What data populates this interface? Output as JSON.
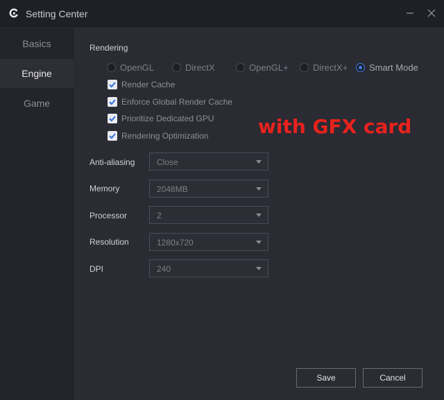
{
  "window": {
    "title": "Setting Center",
    "logo_icon": "app-logo-icon",
    "minimize_icon": "minimize-icon",
    "close_icon": "close-icon"
  },
  "sidebar": {
    "items": [
      {
        "label": "Basics",
        "active": false
      },
      {
        "label": "Engine",
        "active": true
      },
      {
        "label": "Game",
        "active": false
      }
    ]
  },
  "rendering": {
    "title": "Rendering",
    "modes": [
      {
        "label": "OpenGL",
        "selected": false
      },
      {
        "label": "DirectX",
        "selected": false
      },
      {
        "label": "OpenGL+",
        "selected": false
      },
      {
        "label": "DirectX+",
        "selected": false
      },
      {
        "label": "Smart Mode",
        "selected": true
      }
    ],
    "options": [
      {
        "label": "Render Cache",
        "checked": true
      },
      {
        "label": "Enforce Global Render Cache",
        "checked": true
      },
      {
        "label": "Prioritize Dedicated GPU",
        "checked": true
      },
      {
        "label": "Rendering Optimization",
        "checked": true
      }
    ]
  },
  "overlay_text": "with GFX card",
  "settings": [
    {
      "label": "Anti-aliasing",
      "value": "Close"
    },
    {
      "label": "Memory",
      "value": "2048MB"
    },
    {
      "label": "Processor",
      "value": "2"
    },
    {
      "label": "Resolution",
      "value": "1280x720"
    },
    {
      "label": "DPI",
      "value": "240"
    }
  ],
  "footer": {
    "save_label": "Save",
    "cancel_label": "Cancel"
  },
  "colors": {
    "accent": "#3d7ff0",
    "overlay": "#e8221d",
    "background": "#2a2b33"
  }
}
